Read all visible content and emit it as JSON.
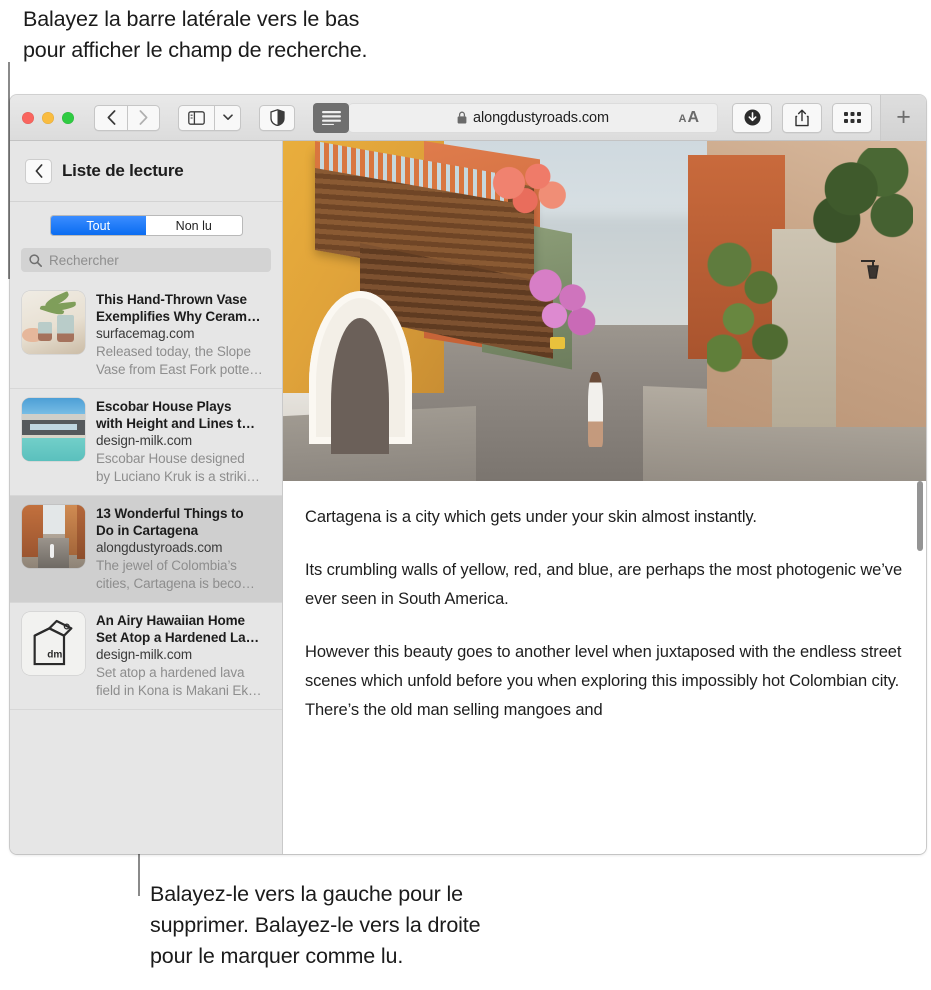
{
  "callouts": {
    "top": "Balayez la barre latérale vers le bas\npour afficher le champ de recherche.",
    "bottom": "Balayez-le vers la gauche pour le\nsupprimer. Balayez-le vers la droite\npour le marquer comme lu."
  },
  "window": {
    "toolbar": {
      "traffic_lights": [
        "close",
        "minimize",
        "zoom"
      ],
      "back_label": "‹",
      "forward_label": "›",
      "sidebar_icon": "sidebar-icon",
      "sidebar_chevron": "chevron-down-icon",
      "shield_icon": "shield-icon",
      "reader_icon": "reader-view-icon",
      "url": "alongdustyroads.com",
      "lock_icon": "lock-icon",
      "text_size_small": "A",
      "text_size_large": "A",
      "download_icon": "download-icon",
      "share_icon": "share-icon",
      "tabs_overview_icon": "tab-overview-icon",
      "new_tab_label": "+"
    },
    "sidebar": {
      "back_icon": "chevron-left-icon",
      "title": "Liste de lecture",
      "segments": [
        {
          "label": "Tout",
          "active": true
        },
        {
          "label": "Non lu",
          "active": false
        }
      ],
      "search": {
        "icon": "search-icon",
        "placeholder": "Rechercher",
        "value": ""
      },
      "items": [
        {
          "title": "This Hand-Thrown Vase\nExemplifies Why Ceram…",
          "site": "surfacemag.com",
          "snippet": "Released today, the Slope\nVase from East Fork potte…",
          "thumb": "vase-thumbnail",
          "selected": false
        },
        {
          "title": "Escobar House Plays\nwith Height and Lines t…",
          "site": "design-milk.com",
          "snippet": "Escobar House designed\nby Luciano Kruk is a striki…",
          "thumb": "house-thumbnail",
          "selected": false
        },
        {
          "title": "13 Wonderful Things to\nDo in Cartagena",
          "site": "alongdustyroads.com",
          "snippet": "The jewel of Colombia’s\ncities, Cartagena is beco…",
          "thumb": "street-thumbnail",
          "selected": true
        },
        {
          "title": "An Airy Hawaiian Home\nSet Atop a Hardened La…",
          "site": "design-milk.com",
          "snippet": "Set atop a hardened lava\nfield in Kona is Makani Ek…",
          "thumb": "design-milk-logo-thumbnail",
          "selected": false
        }
      ]
    },
    "content": {
      "hero_image": "cartagena-street-photo",
      "paragraphs": [
        "Cartagena is a city which gets under your skin almost instantly.",
        "Its crumbling walls of yellow, red, and blue, are perhaps the most photogenic we’ve ever seen in South America.",
        "However this beauty goes to another level when juxtaposed with the endless street scenes which unfold before you when exploring this impossibly hot Colombian city. There’s the old man selling mangoes and"
      ]
    }
  },
  "colors": {
    "accent_blue": "#0a6cf1",
    "sidebar_bg": "#e6e6e6",
    "selected_row": "#cfcfcf",
    "toolbar_bg": "#e2e2e2",
    "reader_active": "#6f6f6f"
  }
}
